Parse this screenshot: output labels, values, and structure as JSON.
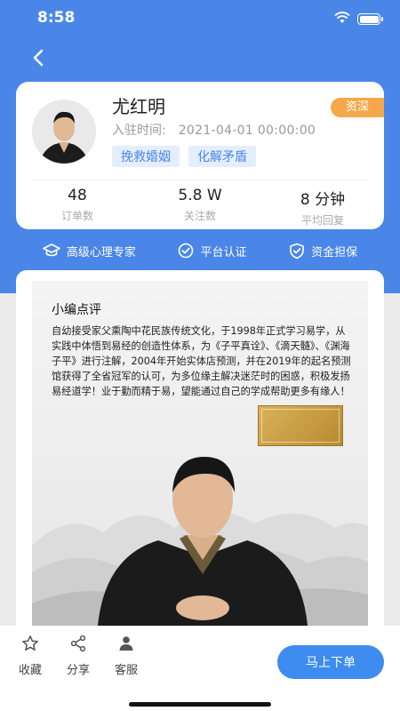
{
  "status_bar": {
    "time": "8:58"
  },
  "profile": {
    "name": "尤红明",
    "join_label": "入驻时间:",
    "join_date": "2021-04-01 00:00:00",
    "badge": "资深",
    "tags": [
      "挽救婚姻",
      "化解矛盾"
    ],
    "stats": [
      {
        "value": "48",
        "label": "订单数"
      },
      {
        "value": "5.8 W",
        "label": "关注数"
      },
      {
        "value": "8 分钟",
        "label": "平均回复"
      }
    ]
  },
  "guarantees": [
    {
      "label": "高级心理专家",
      "icon": "graduation-cap-icon"
    },
    {
      "label": "平台认证",
      "icon": "check-circle-icon"
    },
    {
      "label": "资金担保",
      "icon": "shield-check-icon"
    }
  ],
  "poster": {
    "section_title": "小编点评",
    "intro": "自幼接受家父熏陶中花民族传统文化，于1998年正式学习易学，从实践中体悟到易经的创造性体系，为《子平真诠》、《滴天髓》、《渊海子平》进行注解，2004年开始实体店预测，并在2019年的起名预测馆获得了全省冠军的认可，为多位缘主解决迷茫时的困惑，积极发扬易经道学！业于勤而精于易，望能通过自己的学成帮助更多有缘人！"
  },
  "bottom_bar": {
    "actions": [
      {
        "label": "收藏",
        "icon": "star-icon"
      },
      {
        "label": "分享",
        "icon": "share-icon"
      },
      {
        "label": "客服",
        "icon": "person-icon"
      }
    ],
    "order_button": "马上下单"
  },
  "colors": {
    "primary": "#4a86e8",
    "badge": "#f5a84a",
    "tag_bg": "#e5eefc",
    "order_button": "#3f8cf0"
  }
}
